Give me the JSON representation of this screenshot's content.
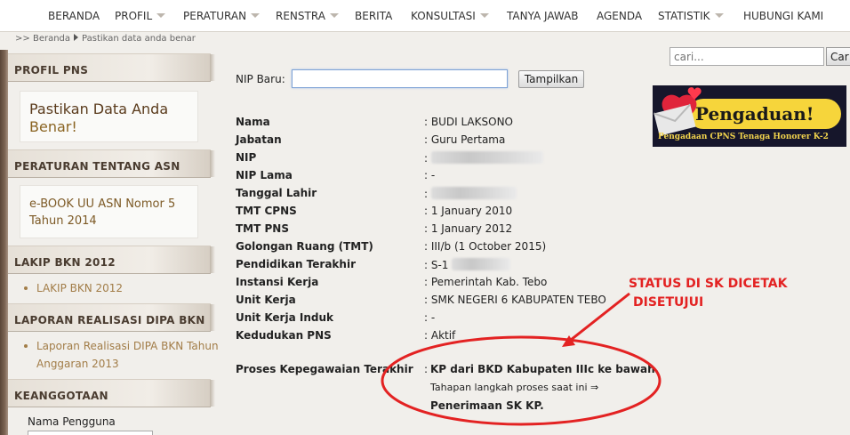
{
  "nav": {
    "items": [
      {
        "label": "BERANDA",
        "dropdown": false
      },
      {
        "label": "PROFIL",
        "dropdown": true
      },
      {
        "label": "PERATURAN",
        "dropdown": true
      },
      {
        "label": "RENSTRA",
        "dropdown": true
      },
      {
        "label": "BERITA",
        "dropdown": false
      },
      {
        "label": "KONSULTASI",
        "dropdown": true
      },
      {
        "label": "TANYA JAWAB",
        "dropdown": false
      },
      {
        "label": "AGENDA",
        "dropdown": false
      },
      {
        "label": "STATISTIK",
        "dropdown": true
      },
      {
        "label": "HUBUNGI KAMI",
        "dropdown": false
      }
    ]
  },
  "breadcrumb": {
    "prefix": ">>",
    "home": "Beranda",
    "current": "Pastikan data anda benar"
  },
  "sidebar": {
    "profil_title": "PROFIL PNS",
    "profil_card_line1": "Pastikan Data Anda",
    "profil_card_line2": "Benar!",
    "peraturan_title": "PERATURAN TENTANG ASN",
    "peraturan_card_line1": "e-BOOK UU ASN Nomor 5",
    "peraturan_card_line2": "Tahun 2014",
    "lakip_title": "LAKIP BKN 2012",
    "lakip_link": "LAKIP BKN 2012",
    "dipa_title": "LAPORAN REALISASI DIPA BKN",
    "dipa_link_line1": "Laporan Realisasi DIPA BKN Tahun",
    "dipa_link_line2": "Anggaran 2013",
    "keanggotaan_title": "KEANGGOTAAN",
    "username_label": "Nama Pengguna"
  },
  "form": {
    "nip_label": "NIP Baru:",
    "nip_value": "",
    "submit_label": "Tampilkan"
  },
  "details": [
    {
      "label": "Nama",
      "value": ": BUDI LAKSONO",
      "blur": 0
    },
    {
      "label": "Jabatan",
      "value": ": Guru Pertama",
      "blur": 0
    },
    {
      "label": "NIP",
      "value": ":",
      "blur": 1
    },
    {
      "label": "NIP Lama",
      "value": ": -",
      "blur": 0
    },
    {
      "label": "Tanggal Lahir",
      "value": ":",
      "blur": 2
    },
    {
      "label": "TMT CPNS",
      "value": ": 1 January 2010",
      "blur": 0
    },
    {
      "label": "TMT PNS",
      "value": ": 1 January 2012",
      "blur": 0
    },
    {
      "label": "Golongan Ruang (TMT)",
      "value": ": III/b (1 October 2015)",
      "blur": 0
    },
    {
      "label": "Pendidikan Terakhir",
      "value": ": S-1",
      "blur": 3
    },
    {
      "label": "Instansi Kerja",
      "value": ": Pemerintah Kab. Tebo",
      "blur": 0
    },
    {
      "label": "Unit Kerja",
      "value": ": SMK NEGERI 6 KABUPATEN TEBO",
      "blur": 0
    },
    {
      "label": "Unit Kerja Induk",
      "value": ": -",
      "blur": 0
    },
    {
      "label": "Kedudukan PNS",
      "value": ": Aktif",
      "blur": 0
    }
  ],
  "proses": {
    "label": "Proses Kepegawaian Terakhir",
    "colon": ":",
    "line1": "KP dari BKD Kabupaten IIIc ke bawah.",
    "line2": "Tahapan langkah proses saat ini ⇒",
    "line3": "Penerimaan SK KP."
  },
  "annotation": {
    "line1": "STATUS DI SK DICETAK",
    "line2": "DISETUJUI",
    "color": "#e32222"
  },
  "search": {
    "placeholder": "cari...",
    "button_label": "Car"
  },
  "banner": {
    "title": "Pengaduan!",
    "subtitle": "Pengadaan CPNS Tenaga Honorer K-2",
    "icon": "envelope-heart-icon"
  },
  "colors": {
    "nav_bg": "#ffffff",
    "page_bg": "#f1efeb",
    "side_link": "#a27d48",
    "banner_bg": "#16162b",
    "banner_sub": "#f2d44d"
  }
}
